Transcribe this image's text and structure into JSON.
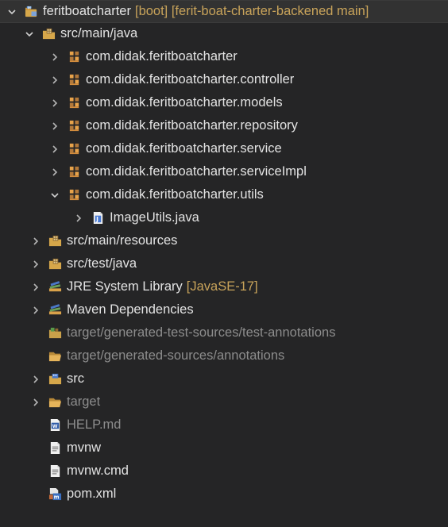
{
  "tree": {
    "root": {
      "label": "feritboatcharter",
      "decoration": "[boot] [ferit-boat-charter-backened main]"
    },
    "items": [
      {
        "label": "src/main/java"
      },
      {
        "label": "com.didak.feritboatcharter"
      },
      {
        "label": "com.didak.feritboatcharter.controller"
      },
      {
        "label": "com.didak.feritboatcharter.models"
      },
      {
        "label": "com.didak.feritboatcharter.repository"
      },
      {
        "label": "com.didak.feritboatcharter.service"
      },
      {
        "label": "com.didak.feritboatcharter.serviceImpl"
      },
      {
        "label": "com.didak.feritboatcharter.utils"
      },
      {
        "label": "ImageUtils.java"
      },
      {
        "label": "src/main/resources"
      },
      {
        "label": "src/test/java"
      },
      {
        "label": "JRE System Library",
        "decoration": "[JavaSE-17]"
      },
      {
        "label": "Maven Dependencies"
      },
      {
        "label": "target/generated-test-sources/test-annotations"
      },
      {
        "label": "target/generated-sources/annotations"
      },
      {
        "label": "src"
      },
      {
        "label": "target"
      },
      {
        "label": "HELP.md"
      },
      {
        "label": "mvnw"
      },
      {
        "label": "mvnw.cmd"
      },
      {
        "label": "pom.xml"
      }
    ]
  },
  "colors": {
    "background": "#252526",
    "text": "#e3e3e3",
    "dim_text": "#8d8d8d",
    "decoration": "#c8a35a"
  }
}
